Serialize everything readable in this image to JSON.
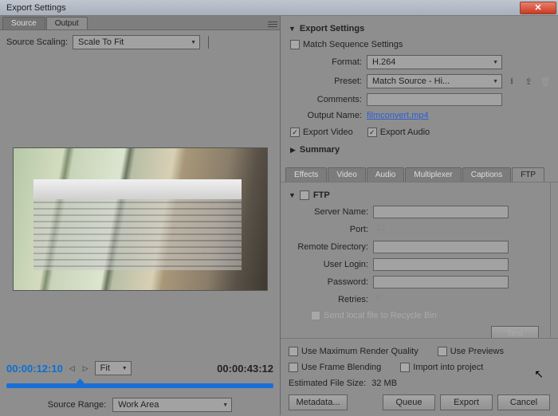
{
  "titlebar": {
    "title": "Export Settings"
  },
  "left": {
    "tabs": {
      "source": "Source",
      "output": "Output"
    },
    "scaling": {
      "label": "Source Scaling:",
      "value": "Scale To Fit"
    },
    "time": {
      "current": "00:00:12:10",
      "duration": "00:00:43:12",
      "fit_label": "Fit"
    },
    "source_range": {
      "label": "Source Range:",
      "value": "Work Area"
    }
  },
  "export": {
    "section": "Export Settings",
    "match_seq": "Match Sequence Settings",
    "format_label": "Format:",
    "format_value": "H.264",
    "preset_label": "Preset:",
    "preset_value": "Match Source - Hi...",
    "comments_label": "Comments:",
    "comments_value": "",
    "output_name_label": "Output Name:",
    "output_name_value": "filmconvert.mp4",
    "export_video": "Export Video",
    "export_audio": "Export Audio",
    "summary": "Summary"
  },
  "subtabs": {
    "effects": "Effects",
    "video": "Video",
    "audio": "Audio",
    "multiplexer": "Multiplexer",
    "captions": "Captions",
    "ftp": "FTP"
  },
  "ftp": {
    "title": "FTP",
    "server_name": "Server Name:",
    "port": "Port:",
    "port_value": "21",
    "remote_dir": "Remote Directory:",
    "user_login": "User Login:",
    "password": "Password:",
    "retries": "Retries:",
    "retries_value": "0",
    "recycle": "Send local file to Recycle Bin",
    "test": "Test"
  },
  "bottom": {
    "max_quality": "Use Maximum Render Quality",
    "use_previews": "Use Previews",
    "frame_blend": "Use Frame Blending",
    "import_project": "Import into project",
    "est_label": "Estimated File Size:",
    "est_value": "32 MB",
    "metadata": "Metadata...",
    "queue": "Queue",
    "export": "Export",
    "cancel": "Cancel"
  }
}
